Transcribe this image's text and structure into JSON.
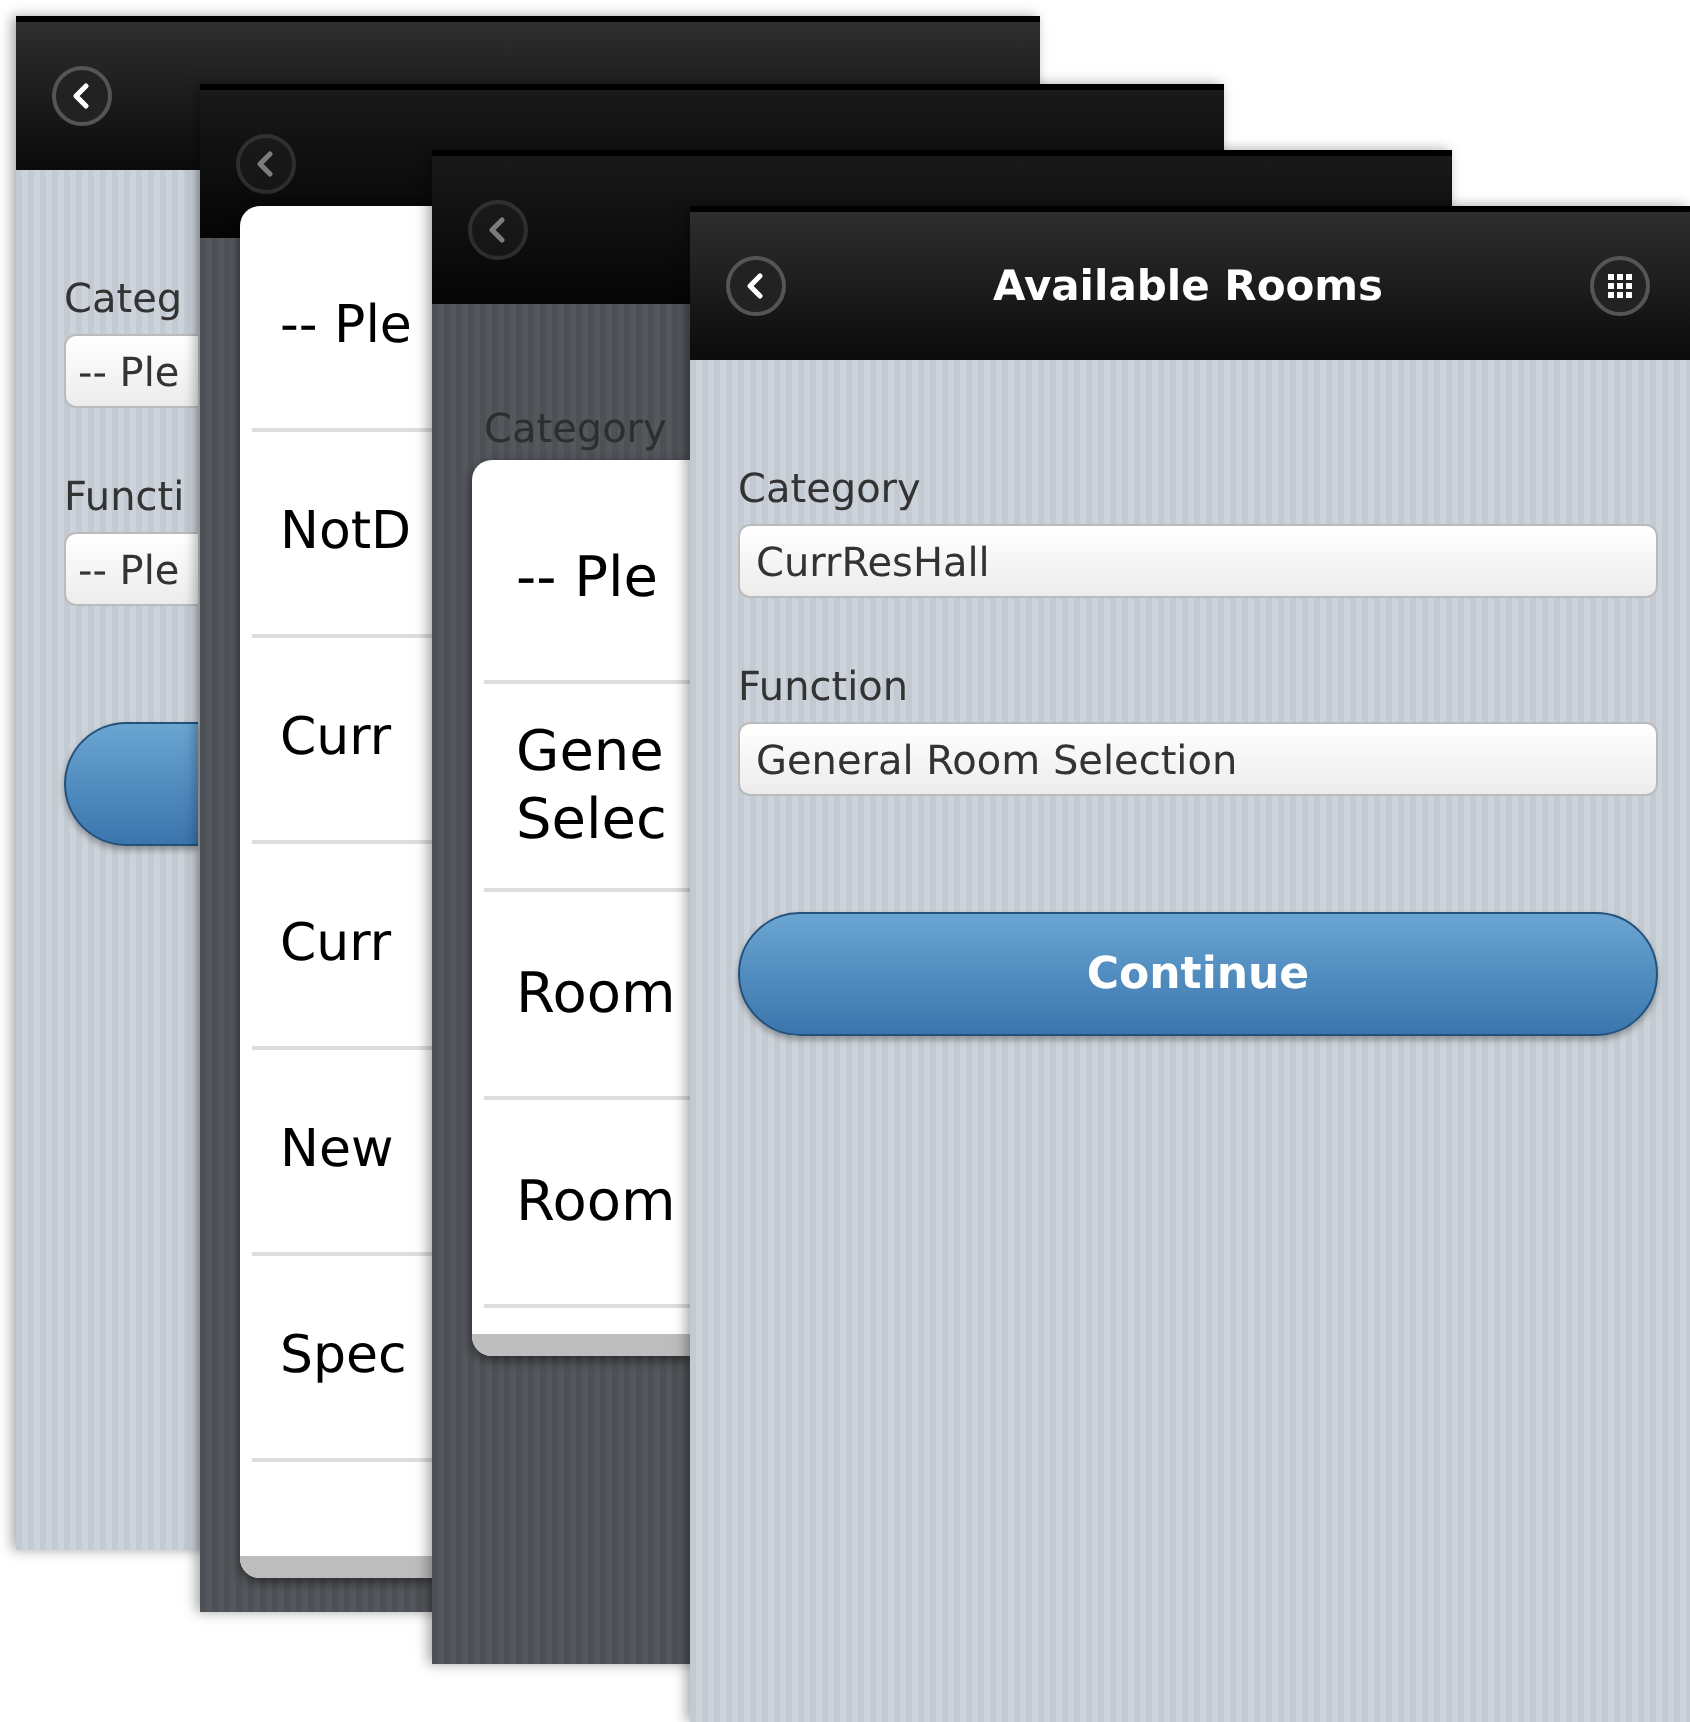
{
  "screens": [
    {
      "kind": "form",
      "fields": [
        {
          "label": "Categ",
          "value": "-- Ple"
        },
        {
          "label": "Functi",
          "value": "-- Ple"
        }
      ],
      "button_shown": true
    },
    {
      "kind": "picker",
      "items": [
        {
          "label": "-- Ple"
        },
        {
          "label": "NotD"
        },
        {
          "label": "Curr"
        },
        {
          "label": "Curr"
        },
        {
          "label": "New"
        },
        {
          "label": "Spec"
        }
      ]
    },
    {
      "kind": "picker",
      "label": "Category",
      "items": [
        {
          "label": "-- Ple"
        },
        {
          "label": "Gene Selec"
        },
        {
          "label": "Room"
        },
        {
          "label": "Room"
        }
      ]
    },
    {
      "kind": "form",
      "title": "Available Rooms",
      "fields": [
        {
          "label": "Category",
          "value": "CurrResHall"
        },
        {
          "label": "Function",
          "value": "General Room Selection"
        }
      ],
      "button_shown": true,
      "button_label": "Continue"
    }
  ]
}
